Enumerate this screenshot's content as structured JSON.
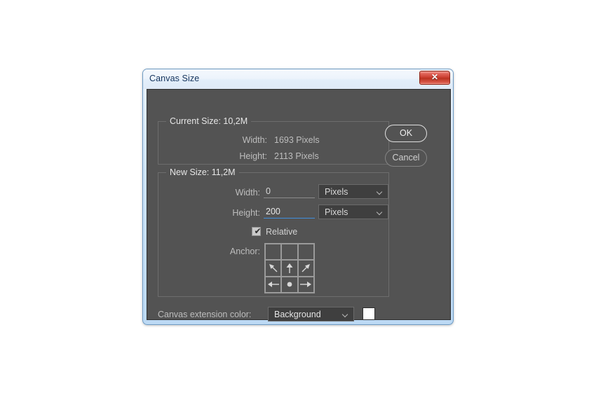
{
  "window": {
    "title": "Canvas Size",
    "close_label": "✕",
    "close_icon": "close-icon"
  },
  "current_size": {
    "legend": "Current Size: 10,2M",
    "width_label": "Width:",
    "width_value": "1693 Pixels",
    "height_label": "Height:",
    "height_value": "2113 Pixels"
  },
  "new_size": {
    "legend": "New Size: 11,2M",
    "width_label": "Width:",
    "width_value": "0",
    "width_unit": "Pixels",
    "height_label": "Height:",
    "height_value": "200",
    "height_unit": "Pixels",
    "relative_label": "Relative",
    "relative_checked": true,
    "relative_check_glyph": "✔",
    "anchor_label": "Anchor:",
    "anchor_selected": "bottom-center",
    "anchor_cells": [
      {
        "name": "anchor-top-left",
        "icon": ""
      },
      {
        "name": "anchor-top-center",
        "icon": ""
      },
      {
        "name": "anchor-top-right",
        "icon": ""
      },
      {
        "name": "anchor-middle-left",
        "icon": "arrow-up-left-icon"
      },
      {
        "name": "anchor-middle-center",
        "icon": "arrow-up-icon"
      },
      {
        "name": "anchor-middle-right",
        "icon": "arrow-up-right-icon"
      },
      {
        "name": "anchor-bottom-left",
        "icon": "arrow-left-icon"
      },
      {
        "name": "anchor-bottom-center",
        "icon": "anchor-dot-icon"
      },
      {
        "name": "anchor-bottom-right",
        "icon": "arrow-right-icon"
      }
    ]
  },
  "extension": {
    "label": "Canvas extension color:",
    "selected": "Background",
    "swatch_color": "#ffffff"
  },
  "buttons": {
    "ok": "OK",
    "cancel": "Cancel"
  },
  "colors": {
    "dialog_bg": "#535353",
    "field_bg": "#3f3f3f",
    "focus_underline": "#3f8fdd",
    "frame": "#bcd9f4",
    "close_red": "#c93b2d"
  }
}
